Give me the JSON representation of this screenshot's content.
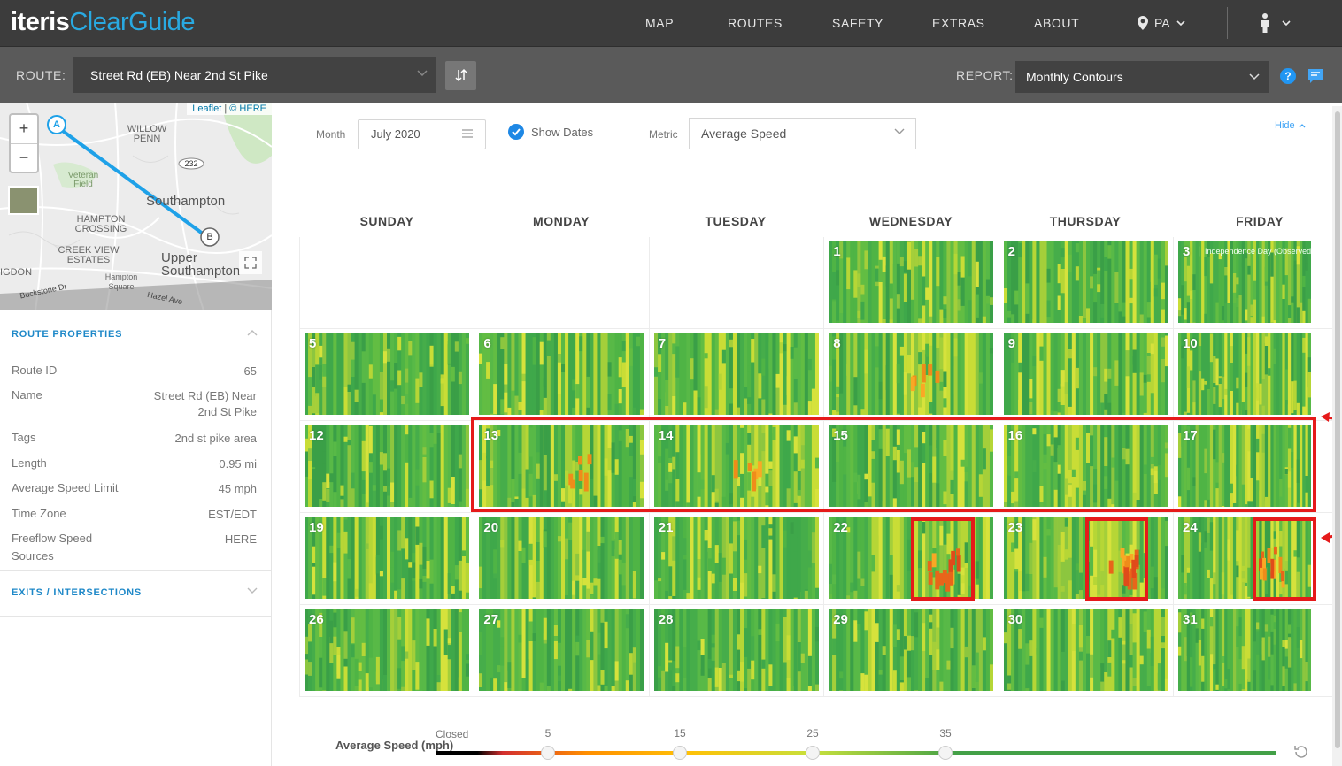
{
  "brand": {
    "part1": "iteris",
    "part2": "ClearGuide"
  },
  "nav": {
    "links": [
      "MAP",
      "ROUTES",
      "SAFETY",
      "EXTRAS",
      "ABOUT"
    ],
    "state": "PA"
  },
  "route_bar": {
    "route_label": "ROUTE:",
    "route_value": "Street Rd (EB) Near 2nd St Pike",
    "report_label": "REPORT:",
    "report_value": "Monthly Contours",
    "help": "?"
  },
  "map": {
    "zoom_in": "+",
    "zoom_out": "−",
    "attribution_leaflet": "Leaflet",
    "attribution_sep": "|",
    "attribution_here": "© HERE",
    "marker_a": "A",
    "marker_b": "B",
    "road_shield": "232",
    "labels": [
      "WILLOW PENN",
      "Veteran Field",
      "Southampton",
      "HAMPTON CROSSING",
      "CREEK VIEW ESTATES",
      "Upper Southampton",
      "IGDON",
      "Hampton Square",
      "Buckstone Dr",
      "Hazel Ave"
    ]
  },
  "route_properties": {
    "title": "ROUTE PROPERTIES",
    "items": [
      {
        "label": "Route ID",
        "value": "65"
      },
      {
        "label": "Name",
        "value": "Street Rd (EB) Near 2nd St Pike"
      },
      {
        "label": "Tags",
        "value": "2nd st pike area"
      },
      {
        "label": "Length",
        "value": "0.95 mi"
      },
      {
        "label": "Average Speed Limit",
        "value": "45 mph"
      },
      {
        "label": "Time Zone",
        "value": "EST/EDT"
      },
      {
        "label": "Freeflow Speed Sources",
        "value": "HERE"
      }
    ]
  },
  "exits": {
    "title": "EXITS / INTERSECTIONS"
  },
  "controls": {
    "month_label": "Month",
    "month_value": "July 2020",
    "show_dates_label": "Show Dates",
    "show_dates_checked": true,
    "metric_label": "Metric",
    "metric_value": "Average Speed",
    "hide_label": "Hide"
  },
  "calendar": {
    "day_headers": [
      "SUNDAY",
      "MONDAY",
      "TUESDAY",
      "WEDNESDAY",
      "THURSDAY",
      "FRIDAY"
    ],
    "first_weekday_index": 3,
    "days_in_month": 31,
    "holidays": [
      {
        "day": 3,
        "label": "Independence Day (Observed)"
      }
    ],
    "congestion_level": {
      "1": 0.15,
      "2": 0.15,
      "3": 0.1,
      "5": 0.05,
      "6": 0.2,
      "7": 0.3,
      "8": 0.45,
      "9": 0.3,
      "10": 0.3,
      "12": 0.05,
      "13": 0.45,
      "14": 0.55,
      "15": 0.25,
      "16": 0.2,
      "17": 0.25,
      "19": 0.05,
      "20": 0.3,
      "21": 0.3,
      "22": 0.7,
      "23": 0.7,
      "24": 0.7,
      "26": 0.15,
      "27": 0.3,
      "28": 0.3,
      "29": 0.2,
      "30": 0.2,
      "31": 0.2
    }
  },
  "legend": {
    "title": "Average Speed (mph)",
    "closed_label": "Closed",
    "ticks": [
      "5",
      "15",
      "25",
      "35"
    ],
    "colors": {
      "closed": "#000000",
      "low": "#d32f2f",
      "mid": "#ff8f00",
      "amber": "#ffc107",
      "yellowgreen": "#c6e03c",
      "green": "#43a047"
    }
  },
  "colors": {
    "accent_blue": "#1e88c8",
    "annotation_red": "#e51a1a",
    "nav_bg": "#3c3c3c",
    "routebar_bg": "#5a5a5a"
  }
}
